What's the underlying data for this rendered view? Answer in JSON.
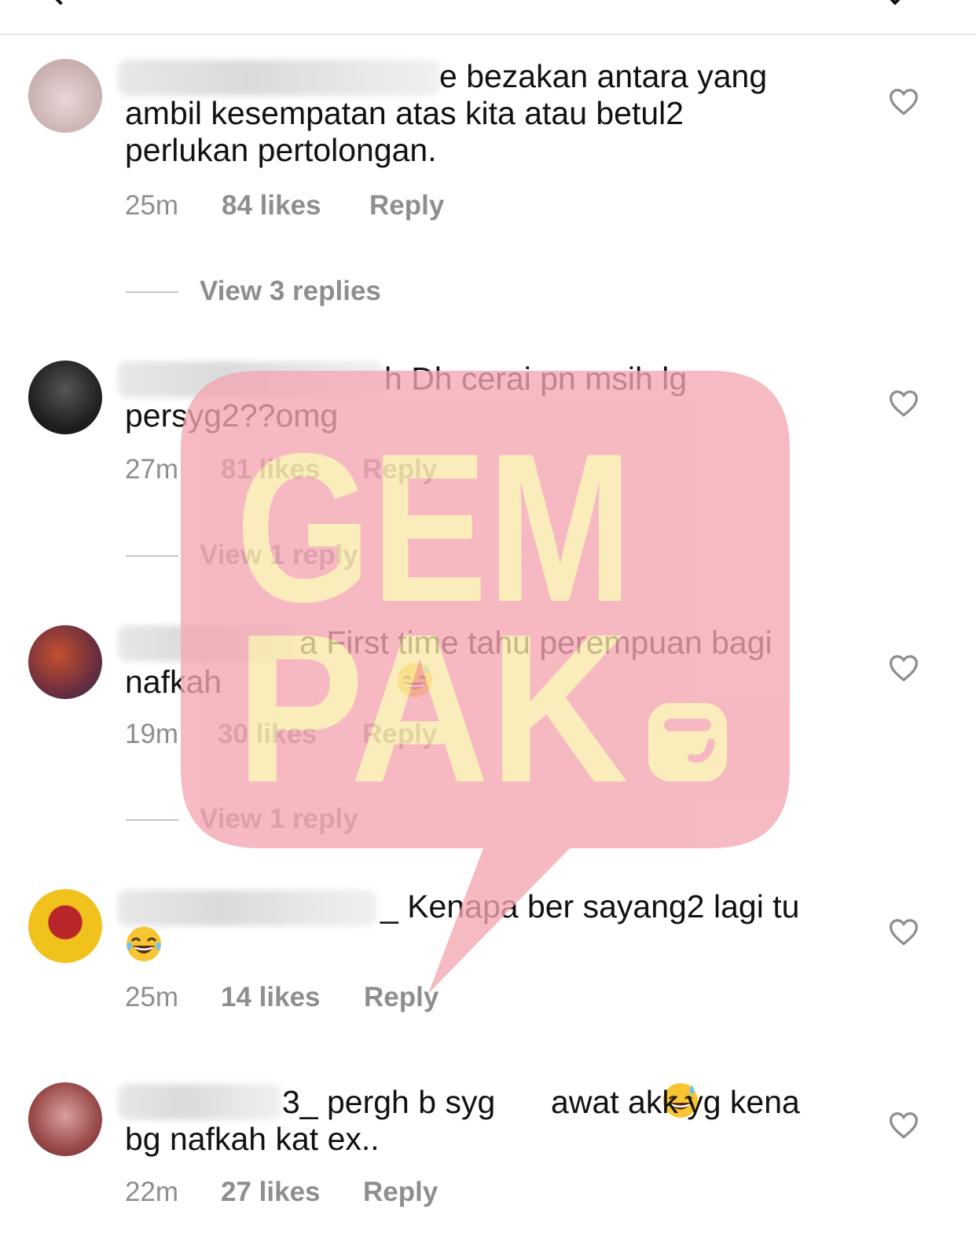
{
  "comments": [
    {
      "text_pre": "",
      "text_main": "e bezakan antara yang\nambil kesempatan atas kita atau betul2\nperlukan pertolongan.",
      "time": "25m",
      "likes": "84 likes",
      "reply": "Reply",
      "view_replies": "View 3 replies",
      "avatar_color": "#d8c4c4"
    },
    {
      "text_main": "h Dh cerai pn msih lg\npersyg2??omg",
      "time": "27m",
      "likes": "81 likes",
      "reply": "Reply",
      "view_replies": "View 1 reply",
      "avatar_color": "#2a2a2a"
    },
    {
      "text_main": "a First time tahu perempuan bagi\nnafkah",
      "emoji": "😅",
      "time": "19m",
      "likes": "30 likes",
      "reply": "Reply",
      "view_replies": "View 1 reply",
      "avatar_color": "#7a3a3a"
    },
    {
      "text_main": "_ Kenapa ber sayang2 lagi tu",
      "emoji": "😂",
      "time": "25m",
      "likes": "14 likes",
      "reply": "Reply",
      "avatar_color": "#f2c21c"
    },
    {
      "text_main_a": "3_ pergh b syg ",
      "emoji": "😅",
      "text_main_b": " awat akk yg kena\nbg nafkah kat ex..",
      "time": "22m",
      "likes": "27 likes",
      "reply": "Reply",
      "avatar_color": "#9a4a4a"
    }
  ],
  "watermark": {
    "line1": "GEM",
    "line2": "PAK",
    "bubble_color": "#f4a6b2",
    "text_color": "#fbe7a8"
  },
  "icons": {
    "heart": "heart-outline-icon",
    "back": "chevron-left-icon",
    "share": "paper-plane-icon"
  }
}
